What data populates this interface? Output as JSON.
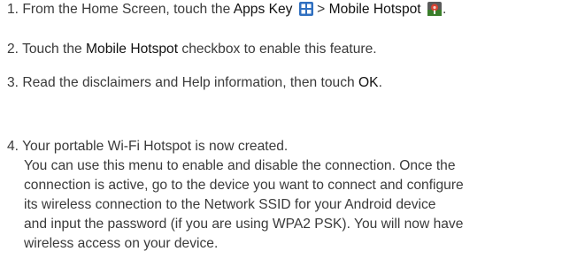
{
  "steps": {
    "s1": {
      "num": "1.",
      "pre": "From the Home Screen, touch the",
      "apps_key": "Apps Key",
      "apps_icon": "apps-grid-icon",
      "sep": ">",
      "hotspot": "Mobile Hotspot",
      "hotspot_icon": "mobile-hotspot-icon",
      "end": "."
    },
    "s2": {
      "num": "2.",
      "pre": "Touch the",
      "bold": "Mobile Hotspot",
      "post": "checkbox to enable this feature."
    },
    "s3": {
      "num": "3.",
      "pre": "Read the disclaimers and Help information, then touch",
      "bold": "OK",
      "end": "."
    },
    "s4": {
      "num": "4.",
      "line1": "Your portable Wi-Fi Hotspot is now created.",
      "l2": "You can use this menu to enable and disable the connection. Once the",
      "l3": "connection is active, go to the device you want to connect and configure",
      "l4": "its wireless connection to the Network SSID for your Android device",
      "l5": "and input the password (if you are using WPA2 PSK). You will now have",
      "l6": "wireless access on your device."
    }
  },
  "colors": {
    "text": "#3a3a3a",
    "emphasis": "#111111",
    "apps_icon": "#2f6fc0",
    "hotspot_icon": "#c0392b"
  }
}
